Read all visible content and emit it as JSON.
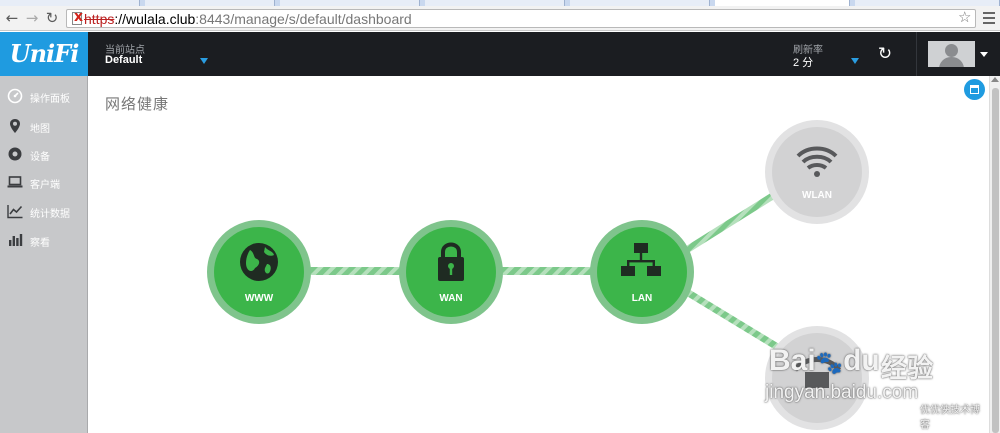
{
  "browser": {
    "url_scheme": "https",
    "url_host": "://wulala.club",
    "url_path": ":8443/manage/s/default/dashboard"
  },
  "header": {
    "logo": "UniFi",
    "site_label": "当前站点",
    "site_value": "Default",
    "refresh_label": "刷新率",
    "refresh_value": "2 分"
  },
  "sidebar": {
    "items": [
      {
        "label": "操作面板",
        "icon": "dashboard-icon"
      },
      {
        "label": "地图",
        "icon": "map-pin-icon"
      },
      {
        "label": "设备",
        "icon": "device-icon"
      },
      {
        "label": "客户端",
        "icon": "laptop-icon"
      },
      {
        "label": "统计数据",
        "icon": "line-chart-icon"
      },
      {
        "label": "察看",
        "icon": "bar-chart-icon"
      }
    ]
  },
  "main": {
    "title": "网络健康",
    "nodes": [
      {
        "label": "WWW",
        "icon": "globe-icon",
        "status": "ok"
      },
      {
        "label": "WAN",
        "icon": "lock-icon",
        "status": "ok"
      },
      {
        "label": "LAN",
        "icon": "network-icon",
        "status": "ok"
      },
      {
        "label": "WLAN",
        "icon": "wifi-icon",
        "status": "inactive"
      },
      {
        "label": "",
        "icon": "vpn-icon",
        "status": "inactive"
      }
    ]
  },
  "watermark": {
    "brand": "Bai",
    "brand2": "du",
    "jingyan": "经验",
    "url": "jingyan.baidu.com",
    "corner": "优优侠技术博客"
  },
  "colors": {
    "accent": "#1f9be0",
    "header_bg": "#1b1d21",
    "sidebar_bg": "#c7c8ca",
    "node_green": "#3cb54a",
    "node_ring": "#78c286",
    "node_grey": "#d2d2d3"
  }
}
